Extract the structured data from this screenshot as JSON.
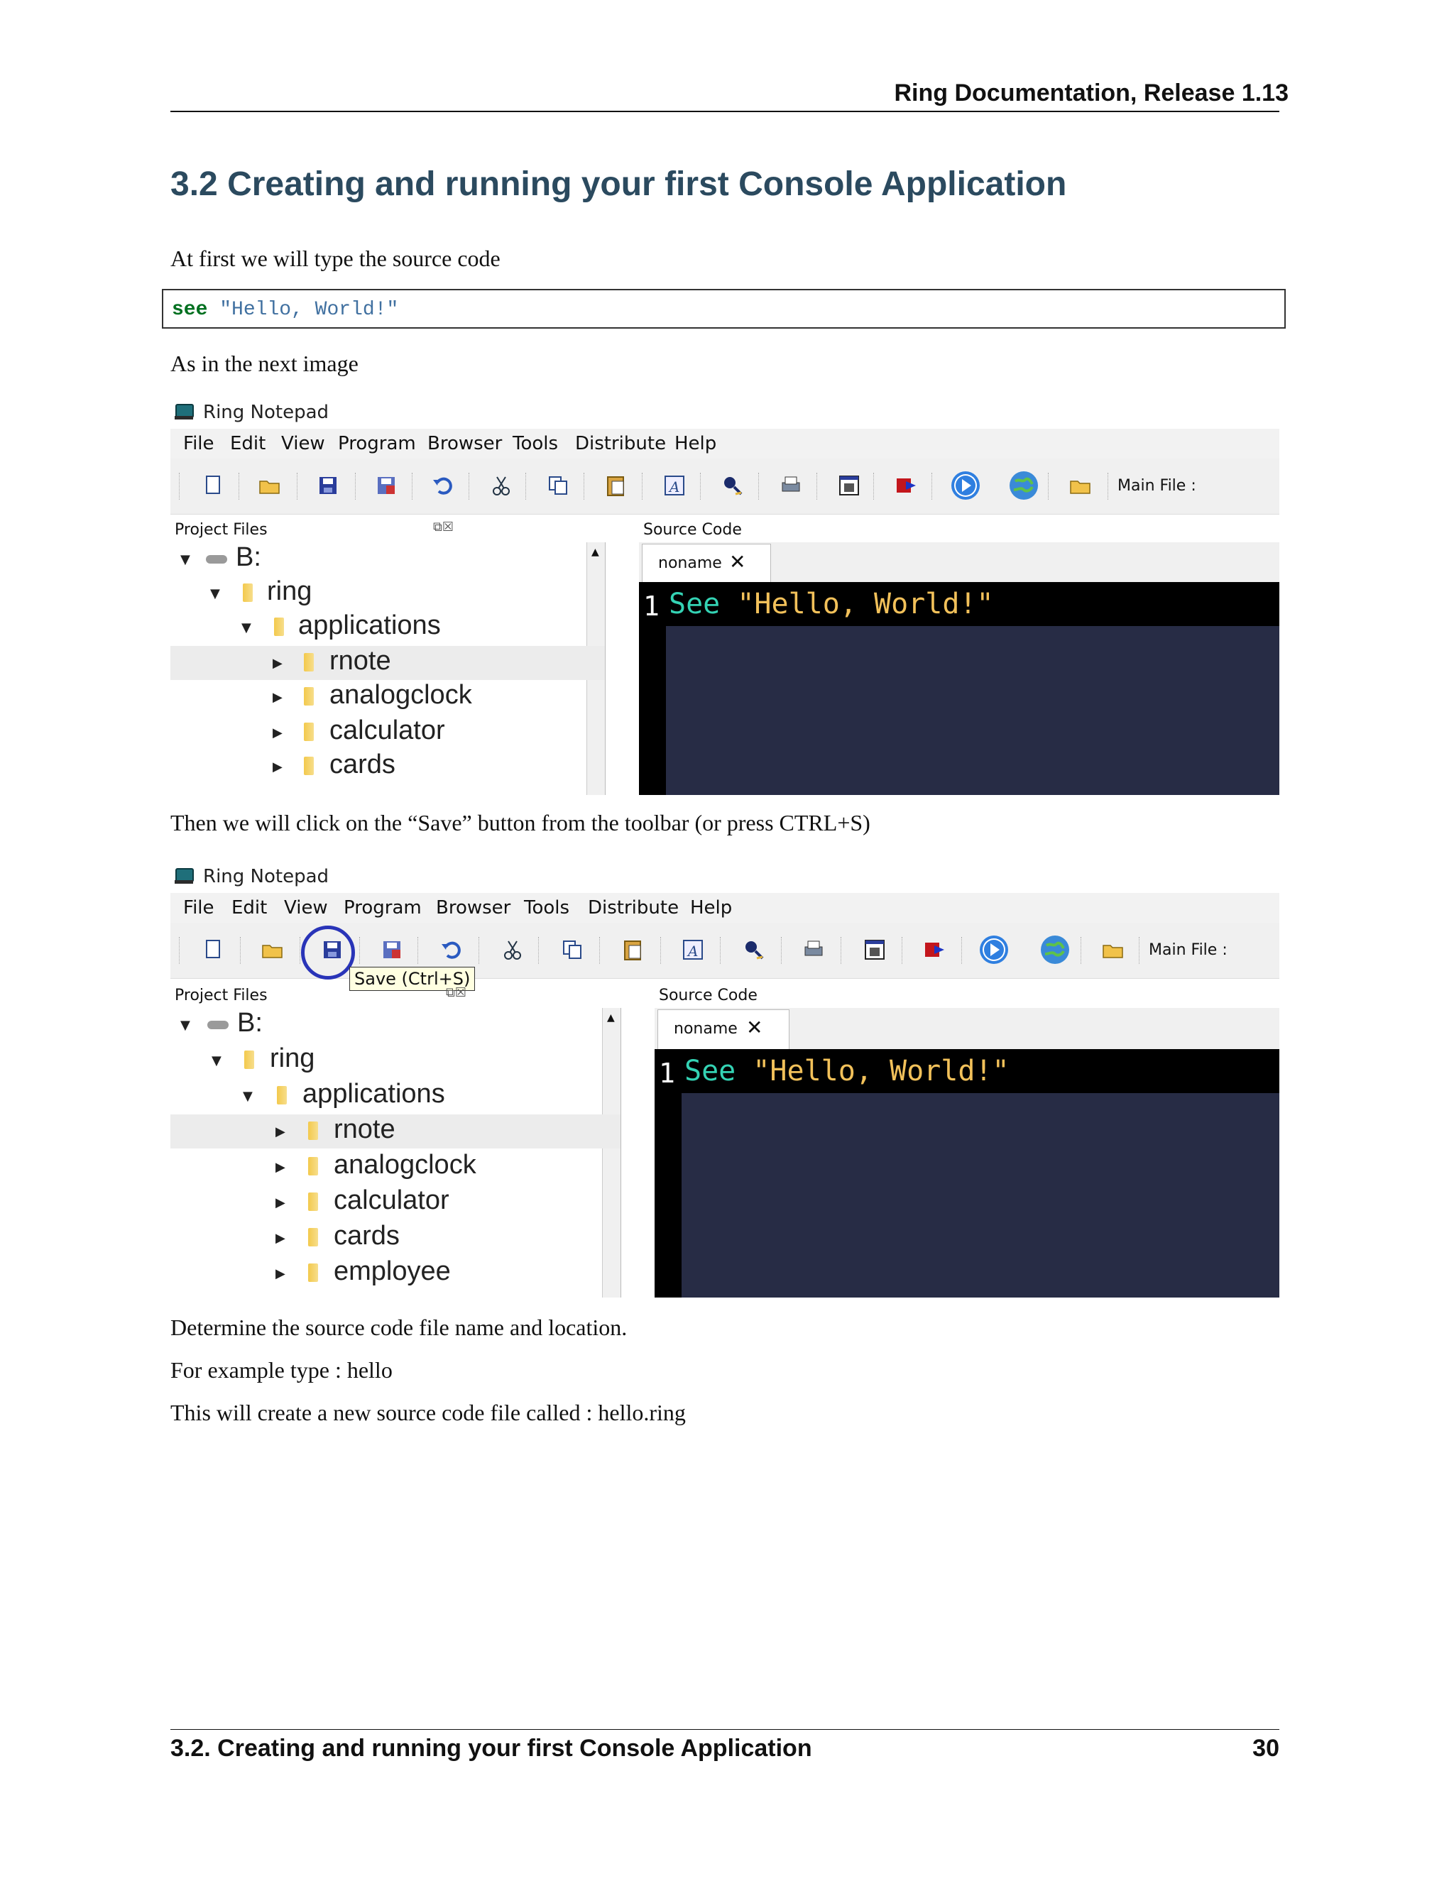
{
  "header": {
    "title": "Ring Documentation, Release 1.13"
  },
  "section": {
    "title": "3.2  Creating and running your first Console Application"
  },
  "paragraphs": {
    "p1": "At first we will type the source code",
    "p2": "As in the next image",
    "p3": "Then we will click on the “Save” button from the toolbar (or press CTRL+S)",
    "p4": "Determine the source code file name and location.",
    "p5": "For example type : hello",
    "p6": "This will create a new source code file called : hello.ring"
  },
  "code_block": {
    "keyword": "see",
    "string": "\"Hello, World!\""
  },
  "app": {
    "window_title": "Ring Notepad",
    "menu": [
      "File",
      "Edit",
      "View",
      "Program",
      "Browser",
      "Tools",
      "Distribute",
      "Help"
    ],
    "toolbar": {
      "icons": [
        "new-file-icon",
        "open-folder-icon",
        "save-icon",
        "save-as-icon",
        "undo-icon",
        "cut-icon",
        "copy-icon",
        "paste-icon",
        "font-icon",
        "find-icon",
        "print-icon",
        "form-designer-icon",
        "debug-icon",
        "run-icon",
        "web-browser-icon",
        "open-folder-icon"
      ],
      "main_file_label": "Main File :"
    },
    "project_files_label": "Project Files",
    "source_code_label": "Source Code",
    "tab_label": "noname",
    "tab_close": "✕",
    "tree": {
      "drive": "B:",
      "ring": "ring",
      "applications": "applications",
      "children": [
        "rnote",
        "analogclock",
        "calculator",
        "cards",
        "employee"
      ]
    },
    "editor": {
      "line_number": "1",
      "keyword": "See",
      "string": "\"Hello, World!\""
    },
    "tooltip": "Save (Ctrl+S)"
  },
  "footer": {
    "section": "3.2.  Creating and running your first Console Application",
    "page": "30"
  },
  "colors": {
    "heading": "#2b4a5f",
    "editor_bg": "#272c45",
    "editor_keyword": "#34d3b4",
    "editor_string": "#f2c15a",
    "highlight_circle": "#2934b8"
  }
}
